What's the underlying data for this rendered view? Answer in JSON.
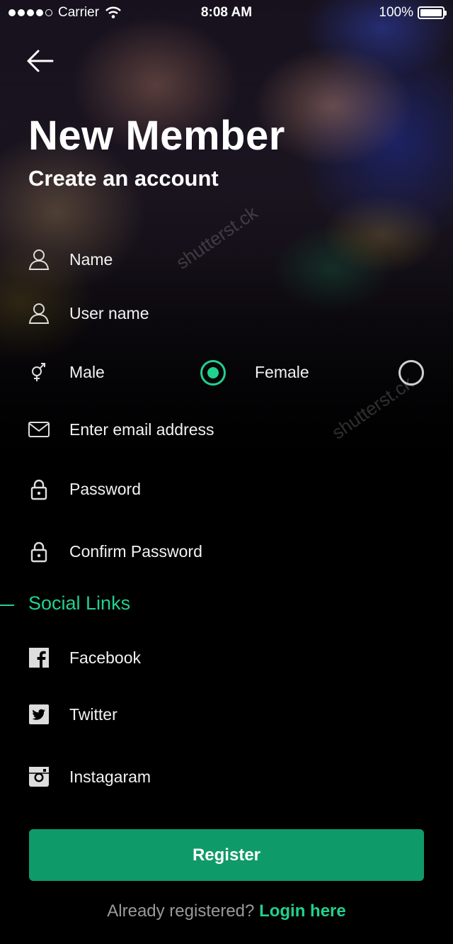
{
  "status_bar": {
    "carrier": "Carrier",
    "time": "8:08 AM",
    "battery": "100%"
  },
  "header": {
    "title": "New Member",
    "subtitle": "Create an account"
  },
  "form": {
    "name": {
      "label": "Name",
      "icon": "user-icon"
    },
    "username": {
      "label": "User name",
      "icon": "user-icon"
    },
    "gender": {
      "icon": "gender-icon",
      "options": [
        {
          "label": "Male",
          "selected": true
        },
        {
          "label": "Female",
          "selected": false
        }
      ]
    },
    "email": {
      "label": "Enter email address",
      "icon": "mail-icon"
    },
    "password": {
      "label": "Password",
      "icon": "lock-icon"
    },
    "confirm_password": {
      "label": "Confirm Password",
      "icon": "lock-icon"
    }
  },
  "social": {
    "heading": "Social Links",
    "links": [
      {
        "label": "Facebook",
        "icon": "facebook-icon"
      },
      {
        "label": "Twitter",
        "icon": "twitter-icon"
      },
      {
        "label": "Instagaram",
        "icon": "instagram-icon"
      }
    ]
  },
  "actions": {
    "register_label": "Register",
    "already_text": "Already registered?",
    "login_link": "Login here"
  },
  "colors": {
    "accent": "#21d18e",
    "button": "#0f9a6a",
    "background": "#000000"
  },
  "watermark": "shutterstock"
}
